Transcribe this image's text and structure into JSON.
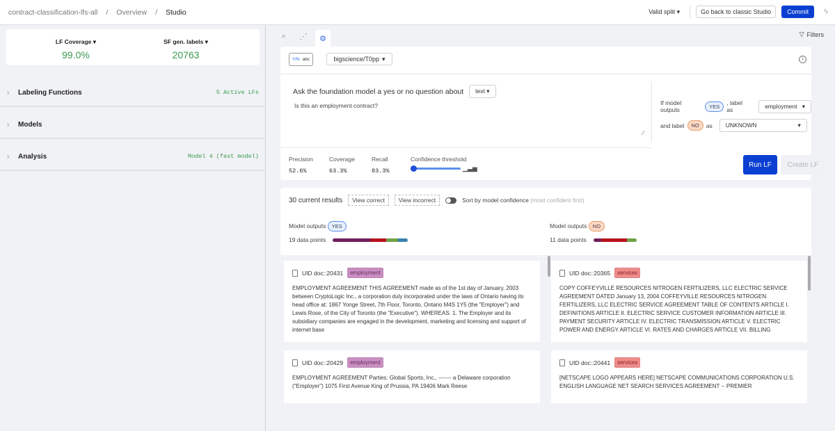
{
  "breadcrumb": [
    "contract-classification-lfs-all",
    "Overview",
    "Studio"
  ],
  "header": {
    "split": "Valid split",
    "classic_button": "Go back to classic Studio",
    "commit_button": "Commit"
  },
  "sidebar": {
    "stats": [
      {
        "label": "LF Coverage",
        "value": "99.0%"
      },
      {
        "label": "SF gen. labels",
        "value": "20763"
      }
    ],
    "sections": [
      {
        "title": "Labeling Functions",
        "badge": "5 Active LFs"
      },
      {
        "title": "Models",
        "badge": ""
      },
      {
        "title": "Analysis",
        "badge": "Model 4 (fast model)"
      }
    ]
  },
  "main": {
    "filters_label": "Filters",
    "toggle": {
      "yn": "Y/N",
      "abc": "abc"
    },
    "model": "bigscience/T0pp",
    "question_prefix": "Ask the foundation model a yes or no question about",
    "field": "text",
    "prompt": "Is this an employment contract?",
    "if_yes_prefix": "If model outputs",
    "yes": "YES",
    "label_as": ", label as",
    "yes_label": "employment",
    "and_label": "and label",
    "no": "NO",
    "as": "as",
    "no_label": "UNKNOWN",
    "metrics": [
      {
        "label": "Precision",
        "value": "52.6%"
      },
      {
        "label": "Coverage",
        "value": "63.3%"
      },
      {
        "label": "Recall",
        "value": "83.3%"
      }
    ],
    "threshold_label": "Confidence threshold",
    "threshold_value": 0,
    "run_button": "Run LF",
    "create_button": "Create LF"
  },
  "results": {
    "count_label": "30 current results",
    "view_correct": "View correct",
    "view_incorrect": "View incorrect",
    "sort_label": "Sort by model confidence",
    "sort_hint": "(most confident first)",
    "model_outputs": "Model outputs",
    "yes_col": {
      "points": "19 data points",
      "distribution": [
        {
          "color": "#6e1f5c",
          "fraction": 0.5
        },
        {
          "color": "#b8121e",
          "fraction": 0.21
        },
        {
          "color": "#6fa245",
          "fraction": 0.16
        },
        {
          "color": "#3d7fb0",
          "fraction": 0.13
        }
      ]
    },
    "no_col": {
      "points": "11 data points",
      "distribution": [
        {
          "color": "#6e1f5c",
          "fraction": 0.18
        },
        {
          "color": "#b8121e",
          "fraction": 0.6
        },
        {
          "color": "#6fa245",
          "fraction": 0.22
        }
      ]
    },
    "cards": [
      {
        "uid": "UID doc::20431",
        "tag": "employment",
        "text": "EMPLOYMENT AGREEMENT THIS AGREEMENT made as of the 1st day of January, 2003 between CryptoLogic Inc., a corporation duly incorporated under the laws of Ontario having its head office at: 1867 Yonge Street, 7th Floor, Toronto, Ontario M4S 1Y5 (the \"Employer\") and Lewis Rose, of the City of Toronto (the \"Executive\"). WHEREAS: 1. The Employer and its subsidiary companies are engaged in the development, marketing and licensing and support of internet base"
      },
      {
        "uid": "UID doc::20365",
        "tag": "services",
        "text": "COPY COFFEYVILLE RESOURCES NITROGEN FERTILIZERS, LLC ELECTRIC SERVICE AGREEMENT DATED January 13, 2004 COFFEYVILLE RESOURCES NITROGEN FERTILIZERS, LLC ELECTRIC SERVICE AGREEMENT TABLE OF CONTENTS ARTICLE I. DEFINITIONS ARTICLE II. ELECTRIC SERVICE CUSTOMER INFORMATION ARTICLE III. PAYMENT SECURITY ARTICLE IV. ELECTRIC TRANSMISSION ARTICLE V. ELECTRIC POWER AND ENERGY ARTICLE VI. RATES AND CHARGES ARTICLE VII. BILLING"
      },
      {
        "uid": "UID doc::20429",
        "tag": "employment",
        "text": "EMPLOYMENT AGREEMENT Parties: Global Sports, Inc., ------- a Delaware corporation (\"Employer\") 1075 First Avenue King of Prussia, PA 19406 Mark Reese"
      },
      {
        "uid": "UID doc::20441",
        "tag": "services",
        "text": "[NETSCAPE LOGO APPEARS HERE] NETSCAPE COMMUNICATIONS CORPORATION U.S. ENGLISH LANGUAGE NET SEARCH SERVICES AGREEMENT -- PREMIER"
      }
    ]
  }
}
